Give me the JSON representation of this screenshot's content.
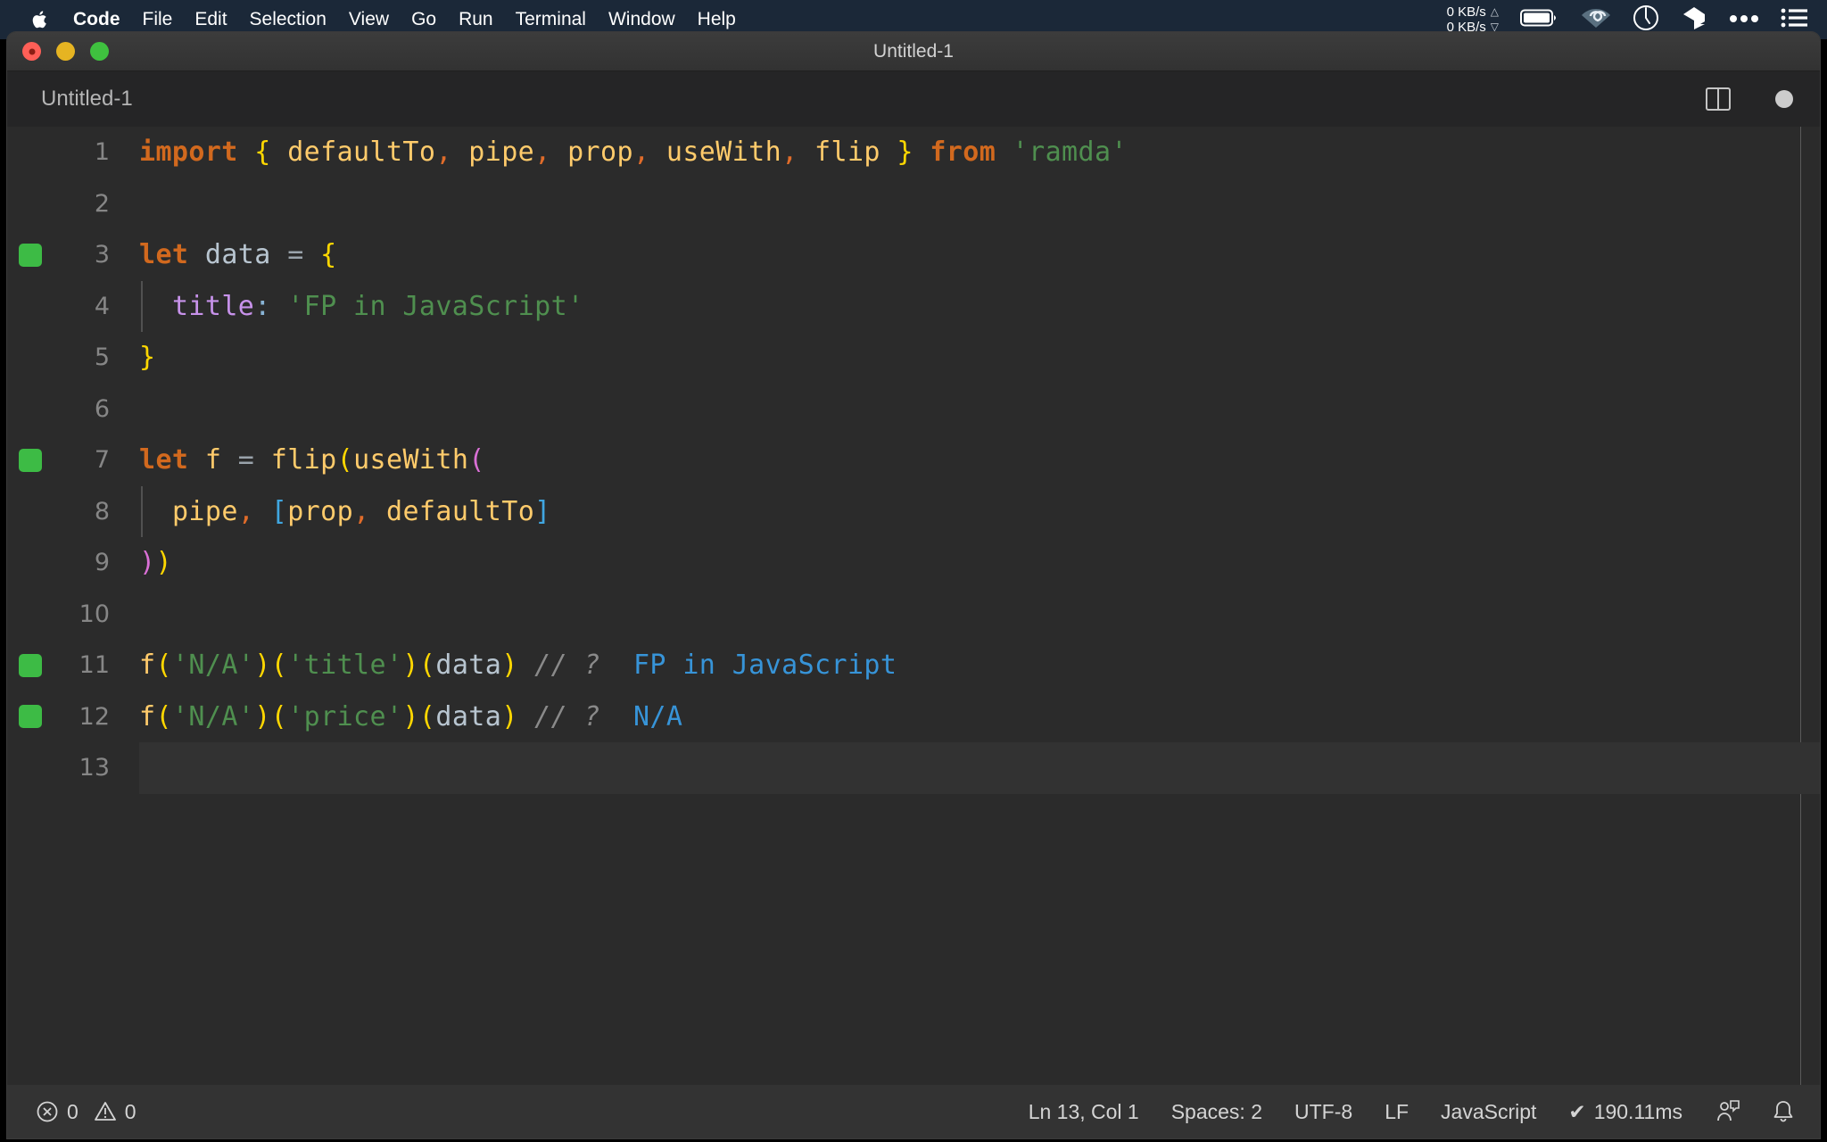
{
  "menubar": {
    "apple_icon": "apple-logo-icon",
    "items": [
      {
        "label": "Code",
        "bold": true
      },
      {
        "label": "File",
        "bold": false
      },
      {
        "label": "Edit",
        "bold": false
      },
      {
        "label": "Selection",
        "bold": false
      },
      {
        "label": "View",
        "bold": false
      },
      {
        "label": "Go",
        "bold": false
      },
      {
        "label": "Run",
        "bold": false
      },
      {
        "label": "Terminal",
        "bold": false
      },
      {
        "label": "Window",
        "bold": false
      },
      {
        "label": "Help",
        "bold": false
      }
    ],
    "network": {
      "upload": "0 KB/s",
      "download": "0 KB/s",
      "up_arrow": "△",
      "down_arrow": "▽"
    },
    "tray_icons": [
      "battery-icon",
      "wifi-icon",
      "clock-icon",
      "dropbox-icon",
      "more-dots-icon",
      "control-center-list-icon"
    ]
  },
  "window": {
    "title": "Untitled-1",
    "traffic_lights": [
      "close-button",
      "minimize-button",
      "maximize-button"
    ]
  },
  "editor": {
    "tab_label": "Untitled-1",
    "actions": [
      "split-editor-icon",
      "unsaved-dot-icon"
    ],
    "current_line": 13,
    "lines": [
      {
        "n": 1,
        "marker": false
      },
      {
        "n": 2,
        "marker": false
      },
      {
        "n": 3,
        "marker": true
      },
      {
        "n": 4,
        "marker": false
      },
      {
        "n": 5,
        "marker": false
      },
      {
        "n": 6,
        "marker": false
      },
      {
        "n": 7,
        "marker": true
      },
      {
        "n": 8,
        "marker": false
      },
      {
        "n": 9,
        "marker": false
      },
      {
        "n": 10,
        "marker": false
      },
      {
        "n": 11,
        "marker": true
      },
      {
        "n": 12,
        "marker": true
      },
      {
        "n": 13,
        "marker": false
      }
    ],
    "code": {
      "l1": {
        "kw_import": "import",
        "brace_open": "{",
        "id1": "defaultTo",
        "c1": ",",
        "id2": "pipe",
        "c2": ",",
        "id3": "prop",
        "c3": ",",
        "id4": "useWith",
        "c4": ",",
        "id5": "flip",
        "brace_close": "}",
        "kw_from": "from",
        "module": "'ramda'"
      },
      "l3": {
        "kw": "let",
        "name": "data",
        "op": "=",
        "brace": "{"
      },
      "l4": {
        "prop": "title",
        "colon": ":",
        "value": "'FP in JavaScript'"
      },
      "l5": {
        "brace": "}"
      },
      "l7": {
        "kw": "let",
        "name": "f",
        "op": "=",
        "fn1": "flip",
        "p1": "(",
        "fn2": "useWith",
        "p2": "("
      },
      "l8": {
        "arg": "pipe",
        "comma": ",",
        "bracket_open": "[",
        "a1": "prop",
        "c1": ",",
        "a2": "defaultTo",
        "bracket_close": "]"
      },
      "l9": {
        "p2": ")",
        "p1": ")"
      },
      "l11": {
        "fn": "f",
        "p_a": "(",
        "s1": "'N/A'",
        "p_b": ")",
        "p_c": "(",
        "s2": "'title'",
        "p_d": ")",
        "p_e": "(",
        "arg": "data",
        "p_f": ")",
        "comment": "// ?",
        "result": "FP in JavaScript"
      },
      "l12": {
        "fn": "f",
        "p_a": "(",
        "s1": "'N/A'",
        "p_b": ")",
        "p_c": "(",
        "s2": "'price'",
        "p_d": ")",
        "p_e": "(",
        "arg": "data",
        "p_f": ")",
        "comment": "// ?",
        "result": "N/A"
      }
    }
  },
  "statusbar": {
    "errors_icon": "error-circle-icon",
    "errors_count": "0",
    "warnings_icon": "warning-triangle-icon",
    "warnings_count": "0",
    "cursor_position": "Ln 13, Col 1",
    "indentation": "Spaces: 2",
    "encoding": "UTF-8",
    "eol": "LF",
    "language": "JavaScript",
    "runtime_check": "✔",
    "runtime": "190.11ms",
    "feedback_icon": "person-feedback-icon",
    "bell_icon": "bell-icon"
  },
  "colors": {
    "menubar_bg": "#1b2838",
    "editor_bg": "#2b2b2b",
    "statusbar_bg": "#333333",
    "marker_green": "#3dbb45",
    "result_blue": "#3794d8",
    "string_green": "#4f8f4f",
    "keyword_orange": "#d2691e",
    "identifier_tan": "#ffcb6b",
    "brace_yellow": "#ffd700",
    "paren_magenta": "#da70d6",
    "bracket_blue": "#40a6e0",
    "property_purple": "#c792ea"
  }
}
